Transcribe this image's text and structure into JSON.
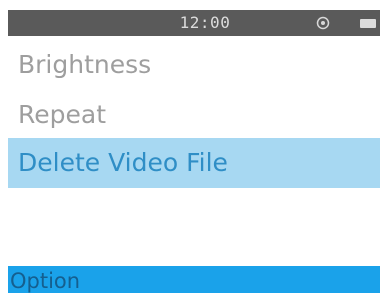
{
  "status_bar": {
    "time": "12:00",
    "icons": [
      "target-icon",
      "battery-icon"
    ]
  },
  "menu": {
    "items": [
      {
        "label": "Brightness",
        "selected": false
      },
      {
        "label": "Repeat",
        "selected": false
      },
      {
        "label": "Delete Video File",
        "selected": true
      }
    ]
  },
  "footer": {
    "title": "Option"
  },
  "colors": {
    "status_bar_bg": "#5a5a5a",
    "menu_text": "#9e9e9e",
    "selected_bg": "#a7d8f2",
    "selected_text": "#2f8ec6",
    "footer_bg": "#1aa2ea",
    "footer_text": "#155f8f"
  }
}
